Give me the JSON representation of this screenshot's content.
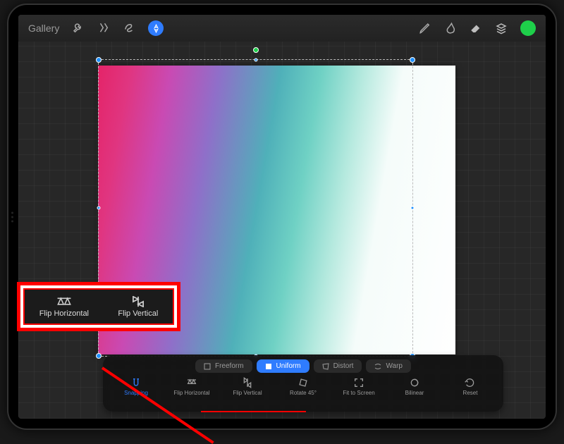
{
  "topbar": {
    "gallery_label": "Gallery"
  },
  "modes": {
    "freeform": "Freeform",
    "uniform": "Uniform",
    "distort": "Distort",
    "warp": "Warp"
  },
  "actions": {
    "snapping": "Snapping",
    "flip_horizontal": "Flip Horizontal",
    "flip_vertical": "Flip Vertical",
    "rotate_45": "Rotate 45°",
    "fit_to_screen": "Fit to Screen",
    "bilinear": "Bilinear",
    "reset": "Reset"
  },
  "callout": {
    "flip_horizontal": "Flip Horizontal",
    "flip_vertical": "Flip Vertical"
  }
}
